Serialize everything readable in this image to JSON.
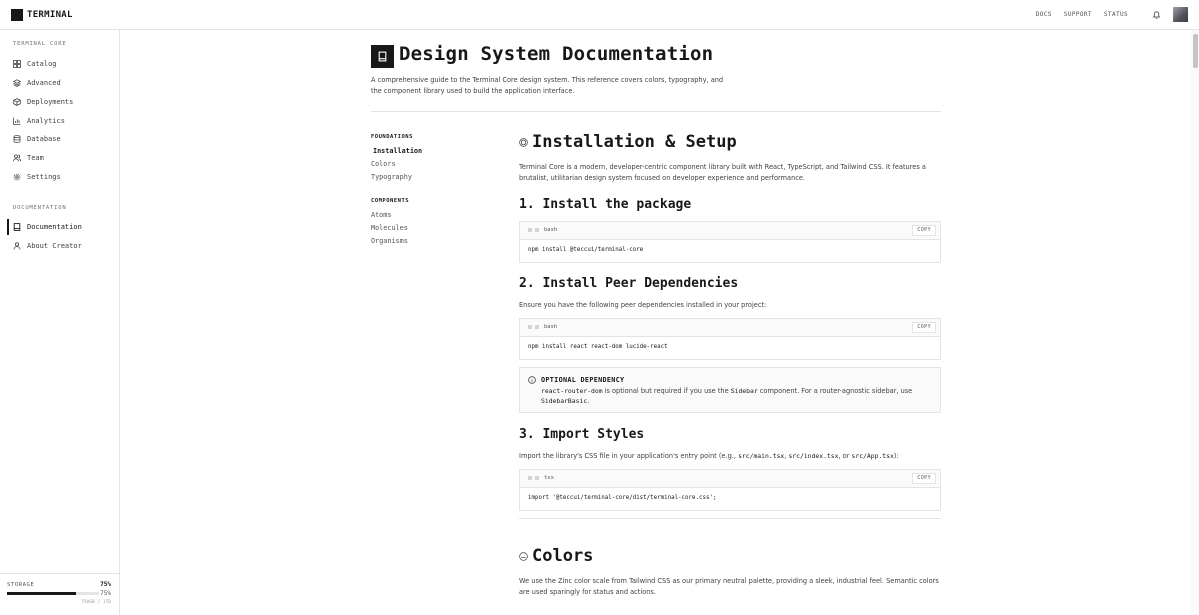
{
  "header": {
    "brand": "TERMINAL",
    "nav": [
      "DOCS",
      "SUPPORT",
      "STATUS"
    ]
  },
  "sidebar": {
    "section_core": "TERMINAL CORE",
    "core_items": [
      {
        "label": "Catalog",
        "icon": "grid-icon"
      },
      {
        "label": "Advanced",
        "icon": "layers-icon"
      },
      {
        "label": "Deployments",
        "icon": "package-icon"
      },
      {
        "label": "Analytics",
        "icon": "chart-icon"
      },
      {
        "label": "Database",
        "icon": "database-icon"
      },
      {
        "label": "Team",
        "icon": "users-icon"
      },
      {
        "label": "Settings",
        "icon": "gear-icon"
      }
    ],
    "section_docs": "DOCUMENTATION",
    "doc_items": [
      {
        "label": "Documentation",
        "icon": "book-icon",
        "active": true
      },
      {
        "label": "About Creator",
        "icon": "user-icon"
      }
    ],
    "storage": {
      "label": "STORAGE",
      "percent": "75%",
      "percent_secondary": "75%",
      "usage": "750GB / 1TB",
      "fraction": 0.75
    }
  },
  "page": {
    "title": "Design System Documentation",
    "intro": "A comprehensive guide to the Terminal Core design system. This reference covers colors, typography, and the component library used to build the application interface."
  },
  "toc": {
    "foundations_head": "FOUNDATIONS",
    "foundations": [
      "Installation",
      "Colors",
      "Typography"
    ],
    "components_head": "COMPONENTS",
    "components": [
      "Atoms",
      "Molecules",
      "Organisms"
    ]
  },
  "installation": {
    "title": "Installation & Setup",
    "description": "Terminal Core is a modern, developer-centric component library built with React, TypeScript, and Tailwind CSS. It features a brutalist, utilitarian design system focused on developer experience and performance.",
    "step1": {
      "title": "1. Install the package",
      "lang": "bash",
      "copy": "COPY",
      "code": "npm install @teccui/terminal-core"
    },
    "step2": {
      "title": "2. Install Peer Dependencies",
      "description": "Ensure you have the following peer dependencies installed in your project:",
      "lang": "bash",
      "copy": "COPY",
      "code": "npm install react react-dom lucide-react"
    },
    "callout": {
      "title": "OPTIONAL DEPENDENCY",
      "code1": "react-router-dom",
      "text1": " is optional but required if you use the ",
      "code2": "Sidebar",
      "text2": " component. For a router-agnostic sidebar, use ",
      "code3": "SidebarBasic",
      "text3": "."
    },
    "step3": {
      "title": "3. Import Styles",
      "desc_prefix": "Import the library's CSS file in your application's entry point (e.g., ",
      "file1": "src/main.tsx",
      "sep1": ", ",
      "file2": "src/index.tsx",
      "sep2": ", or ",
      "file3": "src/App.tsx",
      "desc_suffix": "):",
      "lang": "tsx",
      "copy": "COPY",
      "code": "import '@teccui/terminal-core/dist/terminal-core.css';"
    }
  },
  "colors": {
    "title": "Colors",
    "description": "We use the Zinc color scale from Tailwind CSS as our primary neutral palette, providing a sleek, industrial feel. Semantic colors are used sparingly for status and actions."
  }
}
